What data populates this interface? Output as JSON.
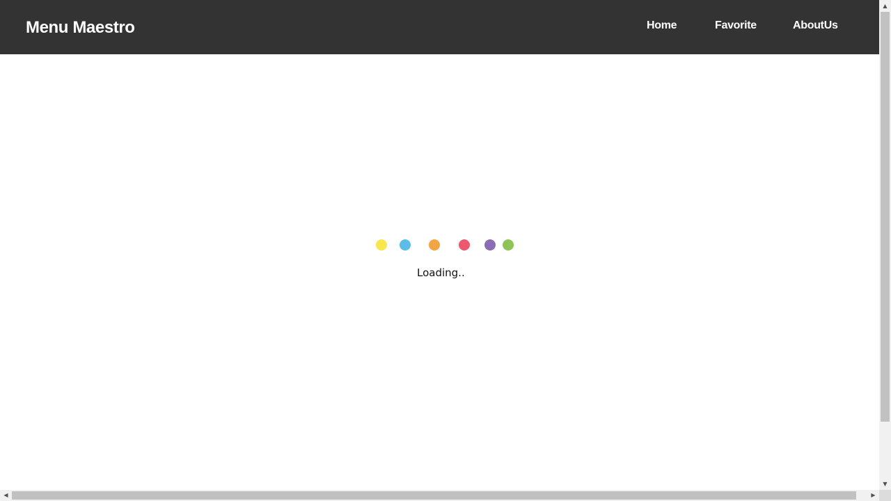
{
  "header": {
    "brand": "Menu Maestro",
    "nav": {
      "home": "Home",
      "favorite": "Favorite",
      "about": "AboutUs"
    }
  },
  "loader": {
    "text": "Loading..",
    "dot_colors": [
      "#f9e64f",
      "#5bbce8",
      "#f3a543",
      "#ec5870",
      "#8c6db5",
      "#8cc456"
    ]
  },
  "scrollbars": {
    "up_icon": "triangle-up-icon",
    "down_icon": "triangle-down-icon",
    "left_icon": "triangle-left-icon",
    "right_icon": "triangle-right-icon"
  }
}
